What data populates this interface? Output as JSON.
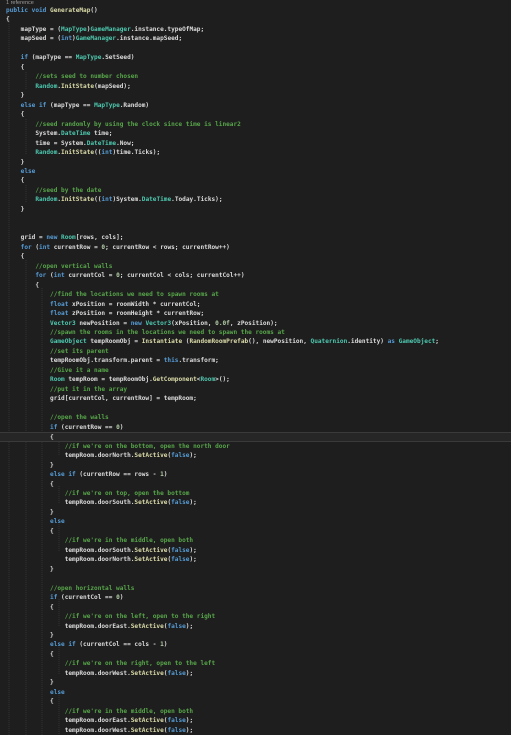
{
  "editor": {
    "reference_label": "1 reference",
    "lines": [
      [
        [
          "k",
          "public void "
        ],
        [
          "m",
          "GenerateMap"
        ],
        [
          "p",
          "()"
        ]
      ],
      [
        [
          "p",
          "{"
        ]
      ],
      [
        [
          "p",
          "    mapType = ("
        ],
        [
          "t",
          "MapType"
        ],
        [
          "p",
          ")"
        ],
        [
          "t",
          "GameManager"
        ],
        [
          "p",
          ".instance.typeOfMap;"
        ]
      ],
      [
        [
          "p",
          "    mapSeed = ("
        ],
        [
          "k",
          "int"
        ],
        [
          "p",
          ")"
        ],
        [
          "t",
          "GameManager"
        ],
        [
          "p",
          ".instance.mapSeed;"
        ]
      ],
      [
        [
          "p",
          ""
        ]
      ],
      [
        [
          "k",
          "    if "
        ],
        [
          "p",
          "(mapType == "
        ],
        [
          "t",
          "MapType"
        ],
        [
          "p",
          ".SetSeed)"
        ]
      ],
      [
        [
          "p",
          "    {"
        ]
      ],
      [
        [
          "c",
          "        //sets seed to number chosen"
        ]
      ],
      [
        [
          "p",
          "        "
        ],
        [
          "t",
          "Random"
        ],
        [
          "p",
          "."
        ],
        [
          "m",
          "InitState"
        ],
        [
          "p",
          "(mapSeed);"
        ]
      ],
      [
        [
          "p",
          "    }"
        ]
      ],
      [
        [
          "k",
          "    else if "
        ],
        [
          "p",
          "(mapType == "
        ],
        [
          "t",
          "MapType"
        ],
        [
          "p",
          ".Random)"
        ]
      ],
      [
        [
          "p",
          "    {"
        ]
      ],
      [
        [
          "c",
          "        //seed randomly by using the clock since time is linear2"
        ]
      ],
      [
        [
          "p",
          "        System."
        ],
        [
          "t",
          "DateTime"
        ],
        [
          "p",
          " time;"
        ]
      ],
      [
        [
          "p",
          "        time = System."
        ],
        [
          "t",
          "DateTime"
        ],
        [
          "p",
          ".Now;"
        ]
      ],
      [
        [
          "p",
          "        "
        ],
        [
          "t",
          "Random"
        ],
        [
          "p",
          "."
        ],
        [
          "m",
          "InitState"
        ],
        [
          "p",
          "(("
        ],
        [
          "k",
          "int"
        ],
        [
          "p",
          ")time.Ticks);"
        ]
      ],
      [
        [
          "p",
          "    }"
        ]
      ],
      [
        [
          "k",
          "    else"
        ]
      ],
      [
        [
          "p",
          "    {"
        ]
      ],
      [
        [
          "c",
          "        //seed by the date"
        ]
      ],
      [
        [
          "p",
          "        "
        ],
        [
          "t",
          "Random"
        ],
        [
          "p",
          "."
        ],
        [
          "m",
          "InitState"
        ],
        [
          "p",
          "(("
        ],
        [
          "k",
          "int"
        ],
        [
          "p",
          ")System."
        ],
        [
          "t",
          "DateTime"
        ],
        [
          "p",
          ".Today.Ticks);"
        ]
      ],
      [
        [
          "p",
          "    }"
        ]
      ],
      [
        [
          "p",
          ""
        ]
      ],
      [
        [
          "p",
          ""
        ]
      ],
      [
        [
          "p",
          "    grid = "
        ],
        [
          "k",
          "new "
        ],
        [
          "t",
          "Room"
        ],
        [
          "p",
          "[rows, cols];"
        ]
      ],
      [
        [
          "k",
          "    for "
        ],
        [
          "p",
          "("
        ],
        [
          "k",
          "int "
        ],
        [
          "p",
          "currentRow = "
        ],
        [
          "n",
          "0"
        ],
        [
          "p",
          "; currentRow < rows; currentRow++)"
        ]
      ],
      [
        [
          "p",
          "    {"
        ]
      ],
      [
        [
          "c",
          "        //open vertical walls"
        ]
      ],
      [
        [
          "k",
          "        for "
        ],
        [
          "p",
          "("
        ],
        [
          "k",
          "int "
        ],
        [
          "p",
          "currentCol = "
        ],
        [
          "n",
          "0"
        ],
        [
          "p",
          "; currentCol < cols; currentCol++)"
        ]
      ],
      [
        [
          "p",
          "        {"
        ]
      ],
      [
        [
          "c",
          "            //find the locations we need to spawn rooms at"
        ]
      ],
      [
        [
          "k",
          "            float "
        ],
        [
          "p",
          "xPosition = roomWidth * currentCol;"
        ]
      ],
      [
        [
          "k",
          "            float "
        ],
        [
          "p",
          "zPosition = roomHeight * currentRow;"
        ]
      ],
      [
        [
          "t",
          "            Vector3 "
        ],
        [
          "p",
          "newPosition = "
        ],
        [
          "k",
          "new "
        ],
        [
          "t",
          "Vector3"
        ],
        [
          "p",
          "(xPosition, "
        ],
        [
          "n",
          "0.0f"
        ],
        [
          "p",
          ", zPosition);"
        ]
      ],
      [
        [
          "c",
          "            //spawn the rooms in the locations we need to spawn the rooms at"
        ]
      ],
      [
        [
          "t",
          "            GameObject "
        ],
        [
          "p",
          "tempRoomObj = "
        ],
        [
          "m",
          "Instantiate "
        ],
        [
          "p",
          "("
        ],
        [
          "m",
          "RandomRoomPrefab"
        ],
        [
          "p",
          "(), newPosition, "
        ],
        [
          "t",
          "Quaternion"
        ],
        [
          "p",
          ".identity) "
        ],
        [
          "k",
          "as "
        ],
        [
          "t",
          "GameObject"
        ],
        [
          "p",
          ";"
        ]
      ],
      [
        [
          "c",
          "            //set its parent"
        ]
      ],
      [
        [
          "p",
          "            tempRoomObj.transform.parent = "
        ],
        [
          "k",
          "this"
        ],
        [
          "p",
          ".transform;"
        ]
      ],
      [
        [
          "c",
          "            //Give it a name"
        ]
      ],
      [
        [
          "t",
          "            Room "
        ],
        [
          "p",
          "tempRoom = tempRoomObj."
        ],
        [
          "m",
          "GetComponent"
        ],
        [
          "p",
          "<"
        ],
        [
          "t",
          "Room"
        ],
        [
          "p",
          ">();"
        ]
      ],
      [
        [
          "c",
          "            //put it in the array"
        ]
      ],
      [
        [
          "p",
          "            grid[currentCol, currentRow] = tempRoom;"
        ]
      ],
      [
        [
          "p",
          ""
        ]
      ],
      [
        [
          "c",
          "            //open the walls"
        ]
      ],
      [
        [
          "k",
          "            if "
        ],
        [
          "p",
          "(currentRow == "
        ],
        [
          "n",
          "0"
        ],
        [
          "p",
          ")"
        ]
      ],
      [
        [
          "p",
          "            {"
        ]
      ],
      [
        [
          "c",
          "                //if we're on the bottom, open the north door"
        ]
      ],
      [
        [
          "p",
          "                tempRoom.doorNorth."
        ],
        [
          "m",
          "SetActive"
        ],
        [
          "p",
          "("
        ],
        [
          "k",
          "false"
        ],
        [
          "p",
          ");"
        ]
      ],
      [
        [
          "p",
          "            }"
        ]
      ],
      [
        [
          "k",
          "            else if "
        ],
        [
          "p",
          "(currentRow == rows - "
        ],
        [
          "n",
          "1"
        ],
        [
          "p",
          ")"
        ]
      ],
      [
        [
          "p",
          "            {"
        ]
      ],
      [
        [
          "c",
          "                //if we're on top, open the bottom"
        ]
      ],
      [
        [
          "p",
          "                tempRoom.doorSouth."
        ],
        [
          "m",
          "SetActive"
        ],
        [
          "p",
          "("
        ],
        [
          "k",
          "false"
        ],
        [
          "p",
          ");"
        ]
      ],
      [
        [
          "p",
          "            }"
        ]
      ],
      [
        [
          "k",
          "            else"
        ]
      ],
      [
        [
          "p",
          "            {"
        ]
      ],
      [
        [
          "c",
          "                //if we're in the middle, open both"
        ]
      ],
      [
        [
          "p",
          "                tempRoom.doorSouth."
        ],
        [
          "m",
          "SetActive"
        ],
        [
          "p",
          "("
        ],
        [
          "k",
          "false"
        ],
        [
          "p",
          ");"
        ]
      ],
      [
        [
          "p",
          "                tempRoom.doorNorth."
        ],
        [
          "m",
          "SetActive"
        ],
        [
          "p",
          "("
        ],
        [
          "k",
          "false"
        ],
        [
          "p",
          ");"
        ]
      ],
      [
        [
          "p",
          "            }"
        ]
      ],
      [
        [
          "p",
          ""
        ]
      ],
      [
        [
          "c",
          "            //open horizontal walls"
        ]
      ],
      [
        [
          "k",
          "            if "
        ],
        [
          "p",
          "(currentCol == "
        ],
        [
          "n",
          "0"
        ],
        [
          "p",
          ")"
        ]
      ],
      [
        [
          "p",
          "            {"
        ]
      ],
      [
        [
          "c",
          "                //if we're on the left, open to the right"
        ]
      ],
      [
        [
          "p",
          "                tempRoom.doorEast."
        ],
        [
          "m",
          "SetActive"
        ],
        [
          "p",
          "("
        ],
        [
          "k",
          "false"
        ],
        [
          "p",
          ");"
        ]
      ],
      [
        [
          "p",
          "            }"
        ]
      ],
      [
        [
          "k",
          "            else if "
        ],
        [
          "p",
          "(currentCol == cols - "
        ],
        [
          "n",
          "1"
        ],
        [
          "p",
          ")"
        ]
      ],
      [
        [
          "p",
          "            {"
        ]
      ],
      [
        [
          "c",
          "                //if we're on the right, open to the left"
        ]
      ],
      [
        [
          "p",
          "                tempRoom.doorWest."
        ],
        [
          "m",
          "SetActive"
        ],
        [
          "p",
          "("
        ],
        [
          "k",
          "false"
        ],
        [
          "p",
          ");"
        ]
      ],
      [
        [
          "p",
          "            }"
        ]
      ],
      [
        [
          "k",
          "            else"
        ]
      ],
      [
        [
          "p",
          "            {"
        ]
      ],
      [
        [
          "c",
          "                //if we're in the middle, open both"
        ]
      ],
      [
        [
          "p",
          "                tempRoom.doorEast."
        ],
        [
          "m",
          "SetActive"
        ],
        [
          "p",
          "("
        ],
        [
          "k",
          "false"
        ],
        [
          "p",
          ");"
        ]
      ],
      [
        [
          "p",
          "                tempRoom.doorWest."
        ],
        [
          "m",
          "SetActive"
        ],
        [
          "p",
          "("
        ],
        [
          "k",
          "false"
        ],
        [
          "p",
          ");"
        ]
      ],
      [
        [
          "p",
          "            }"
        ]
      ]
    ],
    "highlighted_line": 45
  }
}
